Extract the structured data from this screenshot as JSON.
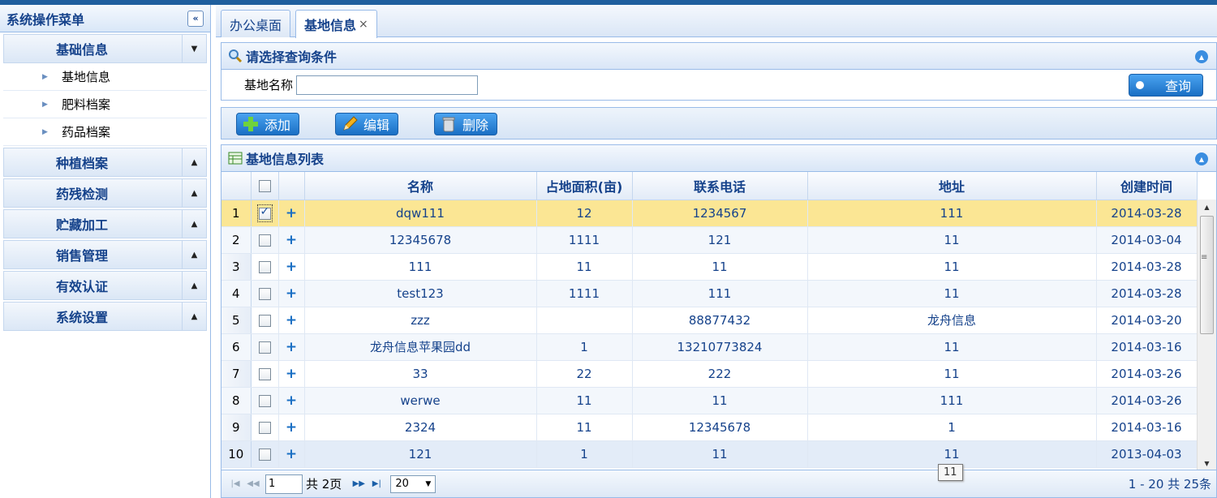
{
  "sidebar": {
    "title": "系统操作菜单",
    "collapse_glyph": "«",
    "groups": [
      {
        "label": "基础信息",
        "arrow": "▼",
        "items": [
          "基地信息",
          "肥料档案",
          "药品档案"
        ]
      },
      {
        "label": "种植档案",
        "arrow": "▲"
      },
      {
        "label": "药残检测",
        "arrow": "▲"
      },
      {
        "label": "贮藏加工",
        "arrow": "▲"
      },
      {
        "label": "销售管理",
        "arrow": "▲"
      },
      {
        "label": "有效认证",
        "arrow": "▲"
      },
      {
        "label": "系统设置",
        "arrow": "▲"
      }
    ]
  },
  "tabs": [
    {
      "label": "办公桌面"
    },
    {
      "label": "基地信息",
      "close": "×"
    }
  ],
  "search": {
    "title": "请选择查询条件",
    "field_label": "基地名称",
    "field_value": "",
    "query_label": "查询"
  },
  "toolbar": {
    "add_label": "添加",
    "edit_label": "编辑",
    "delete_label": "删除"
  },
  "grid": {
    "title": "基地信息列表",
    "columns": [
      "名称",
      "占地面积(亩)",
      "联系电话",
      "地址",
      "创建时间"
    ],
    "expand_glyph": "+",
    "rows": [
      {
        "num": "1",
        "name": "dqw111",
        "area": "12",
        "phone": "1234567",
        "addr": "111",
        "date": "2014-03-28"
      },
      {
        "num": "2",
        "name": "12345678",
        "area": "1111",
        "phone": "121",
        "addr": "11",
        "date": "2014-03-04"
      },
      {
        "num": "3",
        "name": "111",
        "area": "11",
        "phone": "11",
        "addr": "11",
        "date": "2014-03-28"
      },
      {
        "num": "4",
        "name": "test123",
        "area": "1111",
        "phone": "111",
        "addr": "11",
        "date": "2014-03-28"
      },
      {
        "num": "5",
        "name": "zzz",
        "area": "",
        "phone": "88877432",
        "addr": "龙舟信息",
        "date": "2014-03-20"
      },
      {
        "num": "6",
        "name": "龙舟信息苹果园dd",
        "area": "1",
        "phone": "13210773824",
        "addr": "11",
        "date": "2014-03-16"
      },
      {
        "num": "7",
        "name": "33",
        "area": "22",
        "phone": "222",
        "addr": "11",
        "date": "2014-03-26"
      },
      {
        "num": "8",
        "name": "werwe",
        "area": "11",
        "phone": "11",
        "addr": "111",
        "date": "2014-03-26"
      },
      {
        "num": "9",
        "name": "2324",
        "area": "11",
        "phone": "12345678",
        "addr": "1",
        "date": "2014-03-16"
      },
      {
        "num": "10",
        "name": "121",
        "area": "1",
        "phone": "11",
        "addr": "11",
        "date": "2013-04-03"
      }
    ]
  },
  "pager": {
    "page": "1",
    "total_pages_label": "共 2页",
    "page_size": "20",
    "info": "1 - 20   共 25条"
  },
  "tooltip": "11",
  "colors": {
    "accent": "#15428b",
    "button": "#1a6fc4",
    "selected_row": "#fbe694",
    "border": "#99bbe8"
  }
}
